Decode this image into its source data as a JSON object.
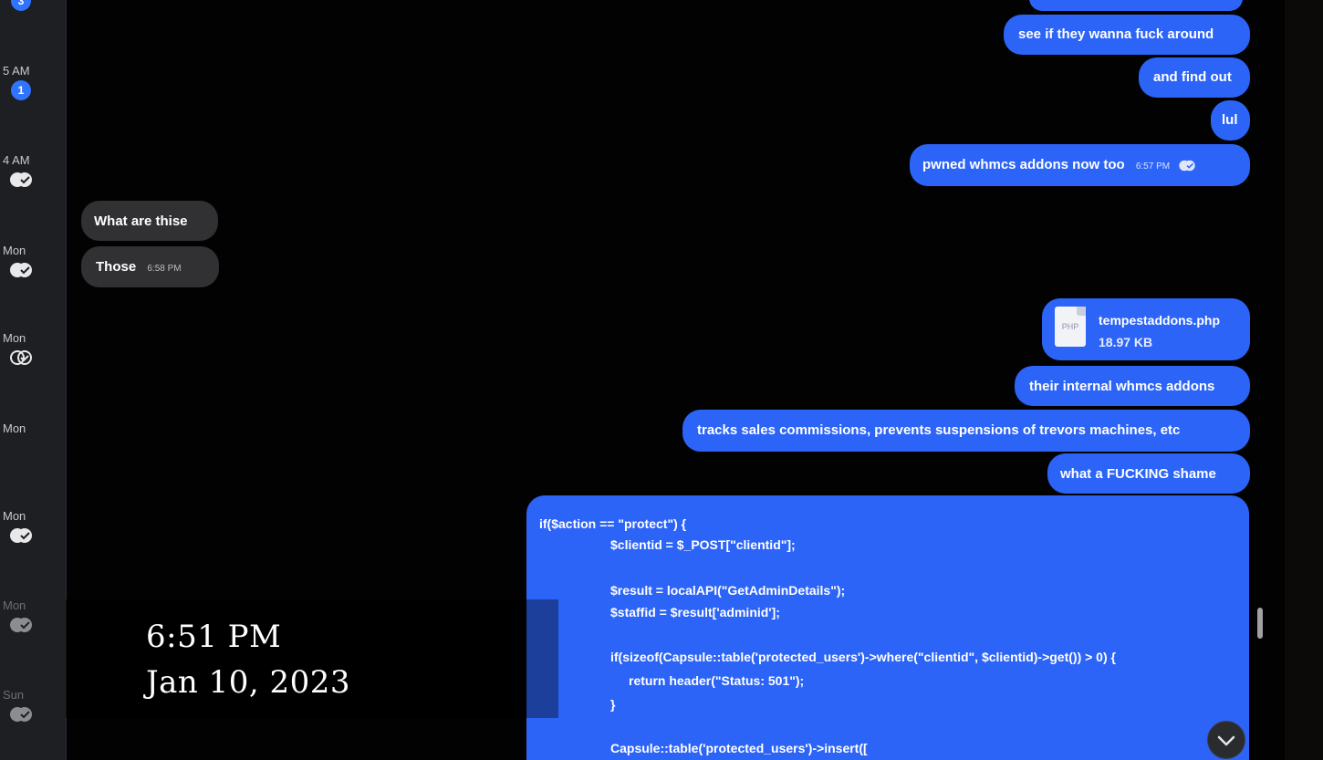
{
  "sidebar": {
    "conversations": [
      {
        "time": "",
        "badge": "3",
        "status": "unread"
      },
      {
        "time": "5 AM",
        "badge": "1",
        "status": "unread"
      },
      {
        "time": "4 AM",
        "badge": "",
        "status": "read"
      },
      {
        "time": "Mon",
        "badge": "",
        "status": "read"
      },
      {
        "time": "Mon",
        "badge": "",
        "status": "delivered"
      },
      {
        "time": "Mon",
        "badge": "",
        "status": "none"
      },
      {
        "time": "Mon",
        "badge": "",
        "status": "read"
      },
      {
        "time": "Mon",
        "badge": "",
        "status": "read"
      },
      {
        "time": "Sun",
        "badge": "",
        "status": "read"
      }
    ]
  },
  "messages": {
    "m1": {
      "text": "see if they wanna fuck around"
    },
    "m2": {
      "text": "and find out"
    },
    "m3": {
      "text": "lul"
    },
    "m4": {
      "text": "pwned whmcs addons now too",
      "time": "6:57 PM",
      "status_icon": "read-receipt-icon"
    },
    "m5": {
      "text": "What are thise"
    },
    "m6": {
      "text": "Those",
      "time": "6:58 PM"
    },
    "file": {
      "name": "tempestaddons.php",
      "size": "18.97 KB",
      "ext": "PHP"
    },
    "m7": {
      "text": "their internal whmcs addons"
    },
    "m8": {
      "text": "tracks sales commissions, prevents suspensions of trevors machines, etc"
    },
    "m9": {
      "text": "what a FUCKING shame"
    }
  },
  "code": {
    "lines": [
      "if($action == \"protect\") {",
      "$clientid = $_POST[\"clientid\"];",
      "$result = localAPI(\"GetAdminDetails\");",
      "$staffid = $result['adminid'];",
      "if(sizeof(Capsule::table('protected_users')->where(\"clientid\", $clientid)->get()) > 0) {",
      "return header(\"Status: 501\");",
      "}",
      "Capsule::table('protected_users')->insert(["
    ]
  },
  "overlay": {
    "time": "6:51 PM",
    "date": "Jan 10, 2023"
  },
  "colors": {
    "outgoing_bubble": "#2c64f7",
    "incoming_bubble": "#313133",
    "background": "#020203"
  }
}
